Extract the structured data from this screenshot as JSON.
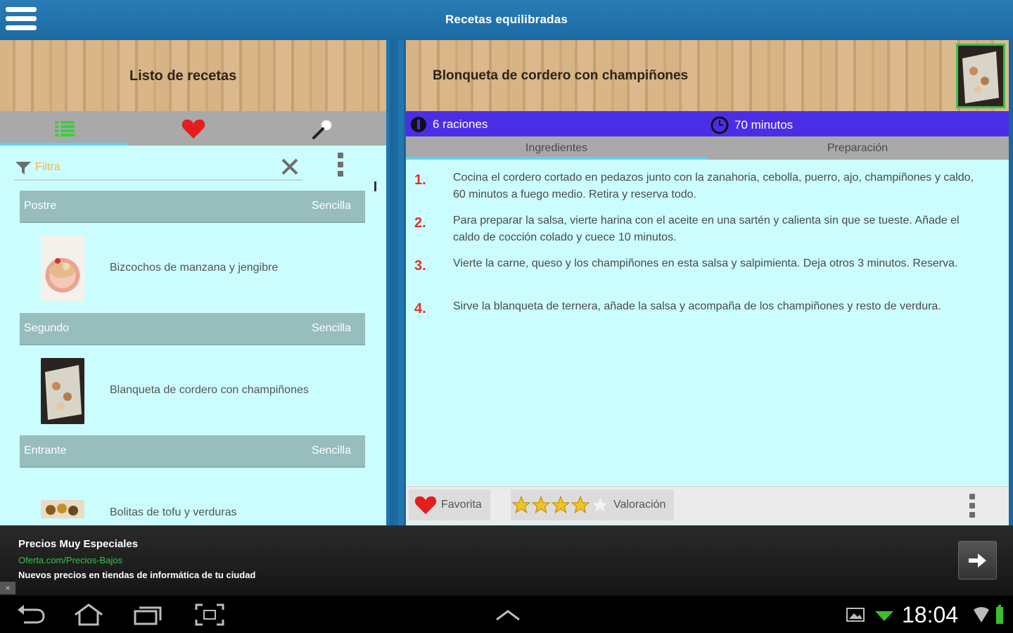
{
  "app": {
    "title": "Recetas equilibradas"
  },
  "left": {
    "header_title": "Listo de recetas",
    "tabs": [
      {
        "icon": "list-icon"
      },
      {
        "icon": "heart-icon"
      },
      {
        "icon": "search-icon"
      }
    ],
    "filter": {
      "placeholder": "Filtra",
      "value": ""
    },
    "sections": [
      {
        "category": "Postre",
        "difficulty": "Sencilla",
        "recipe": "Bizcochos de manzana y jengibre"
      },
      {
        "category": "Segundo",
        "difficulty": "Sencilla",
        "recipe": "Blanqueta de cordero con champiñones"
      },
      {
        "category": "Entrante",
        "difficulty": "Sencilla",
        "recipe": "Bolitas de tofu y verduras"
      }
    ]
  },
  "right": {
    "title": "Blonqueta de cordero con champiñones",
    "servings": "6 raciones",
    "time": "70 minutos",
    "subtabs": [
      "Ingredientes",
      "Preparación"
    ],
    "steps": [
      {
        "num": "1.",
        "text": "Cocina el cordero cortado en pedazos junto con la zanahoria, cebolla, puerro, ajo, champiñones y caldo, 60 minutos a fuego medio. Retira y reserva todo."
      },
      {
        "num": "2.",
        "text": "Para preparar la salsa, vierte harina con el aceite en una sartén y calienta sin que se tueste. Añade el caldo de cocción colado y cuece 10 minutos."
      },
      {
        "num": "3.",
        "text": "Vierte la carne, queso y los champiñones en esta salsa y salpimienta. Deja otros 3 minutos. Reserva."
      },
      {
        "num": "4.",
        "text": "Sirve la blanqueta de ternera, añade la salsa y acompaña de los champiñones y resto de verdura."
      }
    ],
    "favorite_label": "Favorita",
    "rating_label": "Valoración",
    "rating_value": 4,
    "rating_max": 5
  },
  "ad": {
    "title": "Precios Muy Especiales",
    "url": "Oferta.com/Precios-Bajos",
    "description": "Nuevos precios en tiendas de informática de tu ciudad",
    "close": "×"
  },
  "system": {
    "clock": "18:04"
  },
  "colors": {
    "accent": "#4a2ee6",
    "panel_bg": "#ccfdfe",
    "number_red": "#e0302a"
  }
}
